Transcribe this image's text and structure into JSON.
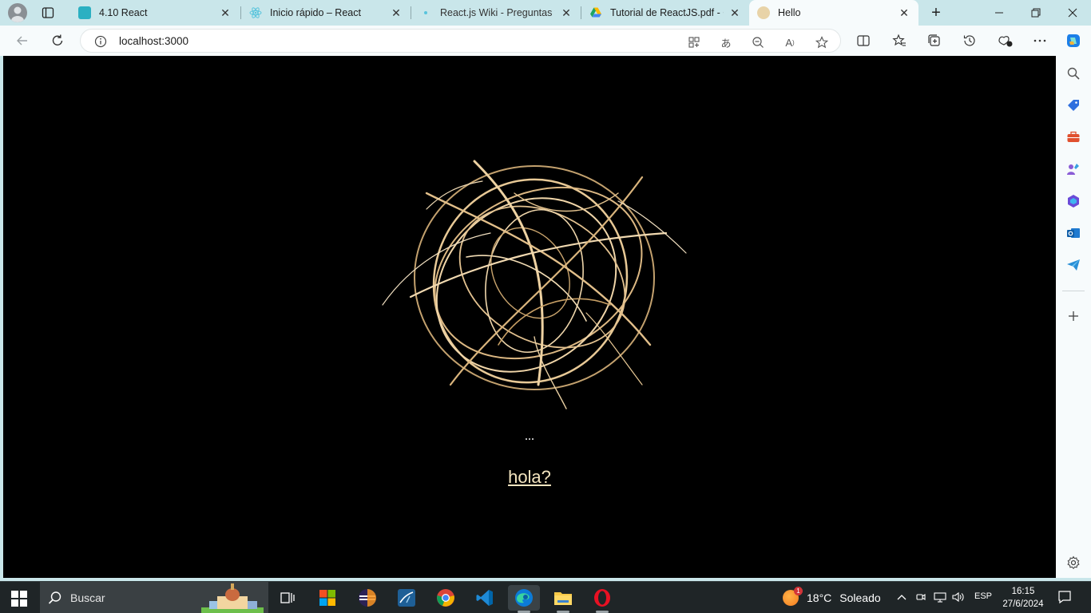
{
  "browser": {
    "tabs": [
      {
        "title": "4.10 React",
        "favicon_color": "#2bb0c2"
      },
      {
        "title": "Inicio rápido – React",
        "favicon_color": "#58c4dc"
      },
      {
        "title": "React.js Wiki - Preguntas típ",
        "favicon_color": "#58c4dc"
      },
      {
        "title": "Tutorial de ReactJS.pdf - Go",
        "favicon_color": "#1fa463"
      },
      {
        "title": "Hello",
        "favicon_color": "#e8d3a8"
      }
    ],
    "address": "localhost:3000"
  },
  "page": {
    "ellipsis": "...",
    "link_text": "hola?",
    "image": "tumbleweed"
  },
  "taskbar": {
    "search_placeholder": "Buscar",
    "weather_temp": "18°C",
    "weather_text": "Soleado",
    "weather_badge": "1",
    "language": "ESP",
    "time": "16:15",
    "date": "27/6/2024"
  },
  "colors": {
    "tabstrip": "#c9e6ea",
    "toolbar": "#f7fbfc",
    "page_bg": "#000000",
    "link": "#f5e6c0"
  }
}
